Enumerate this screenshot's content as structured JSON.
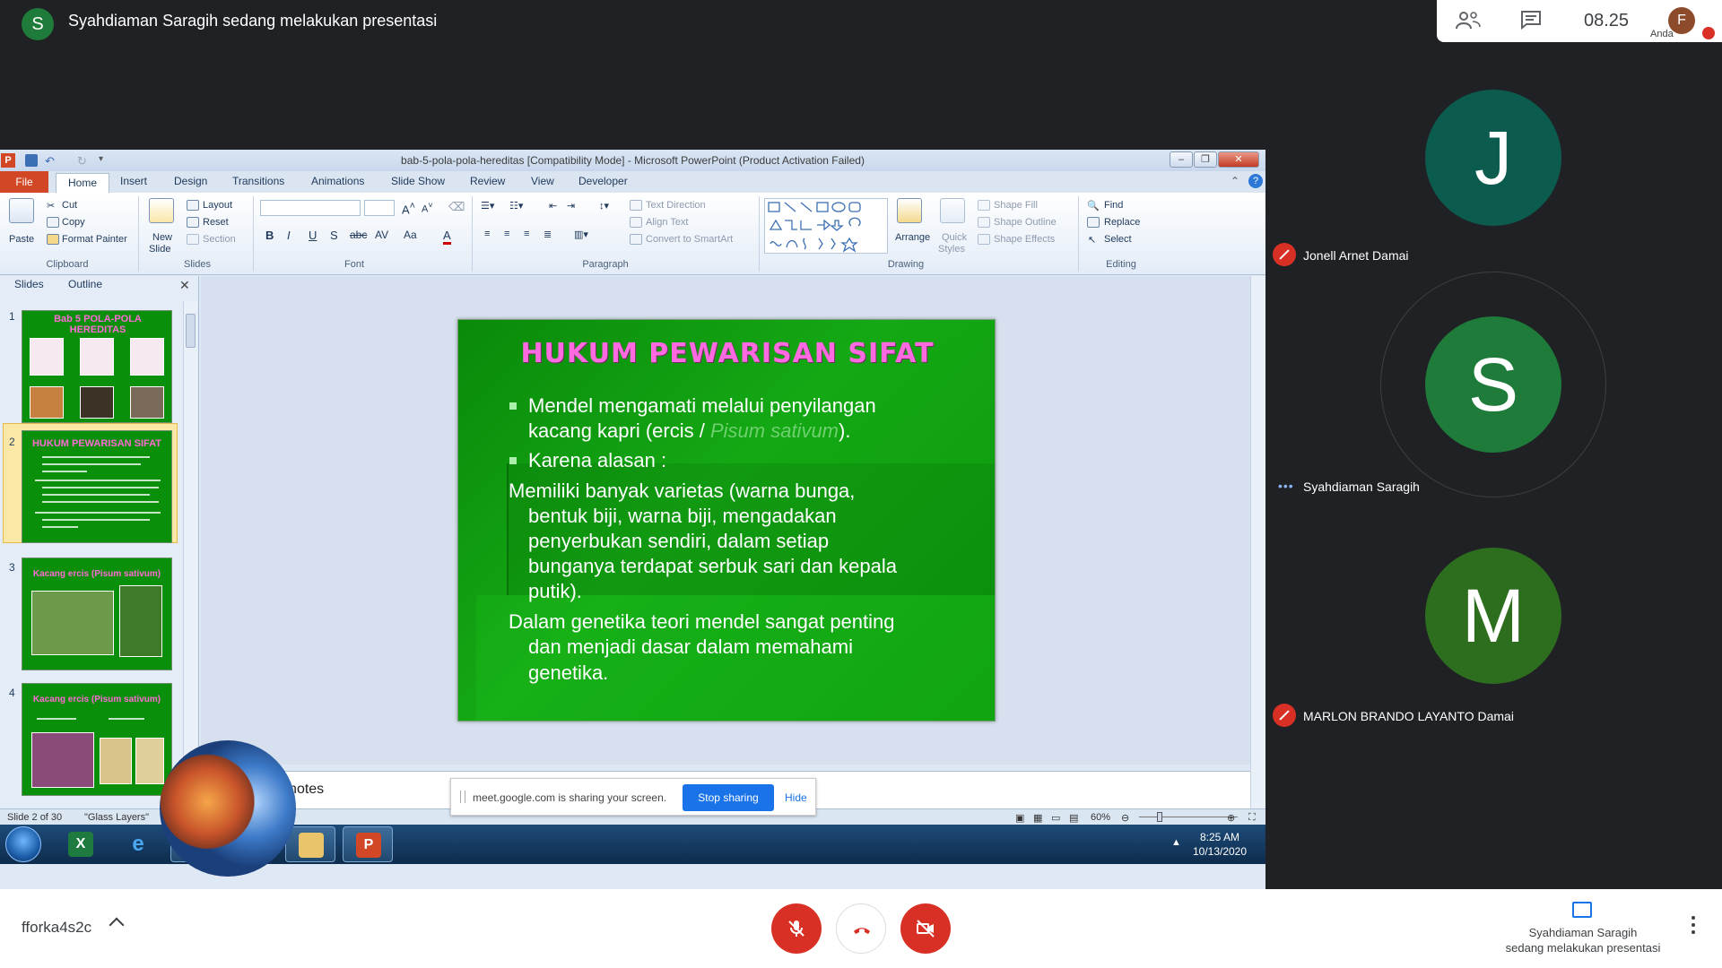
{
  "meet": {
    "presenter_initial": "S",
    "presenter_title": "Syahdiaman Saragih sedang melakukan presentasi",
    "time": "08.25",
    "me_initial": "F",
    "me_label": "Anda",
    "meeting_code": "fforka4s2c",
    "presenting_label_1": "Syahdiaman Saragih",
    "presenting_label_2": "sedang melakukan presentasi",
    "share_bar": {
      "message": "meet.google.com is sharing your screen.",
      "stop": "Stop sharing",
      "hide": "Hide"
    },
    "participants": [
      {
        "initial": "J",
        "name": "Jonell Arnet Damai",
        "color": "#0b5c4f",
        "muted": true
      },
      {
        "initial": "S",
        "name": "Syahdiaman Saragih",
        "color": "#1e7b3a",
        "muted": false,
        "speaking": true
      },
      {
        "initial": "M",
        "name": "MARLON BRANDO LAYANTO Damai",
        "color": "#2d6e1e",
        "muted": true
      }
    ],
    "colors": {
      "danger": "#d93025",
      "primary": "#1a73e8"
    }
  },
  "ppt": {
    "window_title": "bab-5-pola-pola-hereditas [Compatibility Mode]  -  Microsoft PowerPoint (Product Activation Failed)",
    "app_icon": "P",
    "tabs": [
      "File",
      "Home",
      "Insert",
      "Design",
      "Transitions",
      "Animations",
      "Slide Show",
      "Review",
      "View",
      "Developer"
    ],
    "ribbon": {
      "clipboard": {
        "paste": "Paste",
        "cut": "Cut",
        "copy": "Copy",
        "format_painter": "Format Painter",
        "label": "Clipboard"
      },
      "slides": {
        "new_slide_1": "New",
        "new_slide_2": "Slide",
        "layout": "Layout",
        "reset": "Reset",
        "section": "Section",
        "label": "Slides"
      },
      "font": {
        "label": "Font"
      },
      "paragraph": {
        "text_direction": "Text Direction",
        "align_text": "Align Text",
        "convert": "Convert to SmartArt",
        "label": "Paragraph"
      },
      "drawing": {
        "arrange": "Arrange",
        "quick_styles_1": "Quick",
        "quick_styles_2": "Styles",
        "shape_fill": "Shape Fill",
        "shape_outline": "Shape Outline",
        "shape_effects": "Shape Effects",
        "label": "Drawing"
      },
      "editing": {
        "find": "Find",
        "replace": "Replace",
        "select": "Select",
        "label": "Editing"
      }
    },
    "pane_tabs": {
      "slides": "Slides",
      "outline": "Outline"
    },
    "thumbnails": [
      {
        "num": "1",
        "title": "Bab 5 POLA-POLA HEREDITAS"
      },
      {
        "num": "2",
        "title": "HUKUM PEWARISAN SIFAT"
      },
      {
        "num": "3",
        "title": "Kacang ercis (Pisum sativum)"
      },
      {
        "num": "4",
        "title": "Kacang ercis (Pisum sativum)"
      }
    ],
    "slide": {
      "title": "HUKUM PEWARISAN SIFAT",
      "b1_l1": "Mendel mengamati melalui penyilangan",
      "b1_l2a": "kacang kapri (ercis / ",
      "b1_l2b": "Pisum sativum",
      "b1_l2c": ").",
      "b2": "Karena alasan :",
      "p1_l1": "Memiliki banyak varietas (warna bunga,",
      "p1_l2": "bentuk biji, warna biji, mengadakan",
      "p1_l3": "penyerbukan sendiri, dalam setiap",
      "p1_l4": "bunganya terdapat serbuk sari dan kepala",
      "p1_l5": "putik).",
      "p2_l1": "Dalam genetika teori mendel sangat penting",
      "p2_l2": "dan menjadi dasar dalam memahami",
      "p2_l3": "genetika."
    },
    "notes_placeholder": "Click to add notes",
    "status": {
      "slide_of": "Slide 2 of 30",
      "theme": "\"Glass Layers\"",
      "zoom": "60%"
    },
    "clock": {
      "time": "8:25 AM",
      "date": "10/13/2020"
    }
  }
}
